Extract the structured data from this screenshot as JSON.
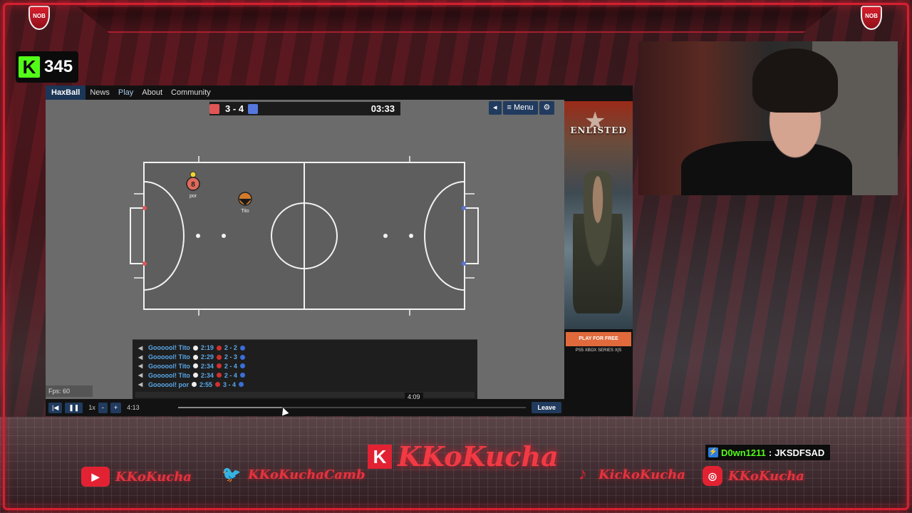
{
  "stream": {
    "viewer_count": "345",
    "kick_logo": "K",
    "crest_label": "NOB"
  },
  "haxball": {
    "nav": {
      "brand": "HaxBall",
      "links": [
        "News",
        "Play",
        "About",
        "Community"
      ]
    },
    "scoreboard": {
      "red_score": "3",
      "separator": "-",
      "blue_score": "4",
      "clock": "03:33",
      "red_color": "#e05555",
      "blue_color": "#5577dd"
    },
    "topbar": {
      "back_icon": "triangle-left-icon",
      "menu_label": "≡ Menu",
      "settings_icon": "gear-icon"
    },
    "players": [
      {
        "number": "8",
        "name": "por",
        "team": "red"
      },
      {
        "number": "",
        "name": "Tito",
        "team": "mixed"
      }
    ],
    "fps": "Fps: 60",
    "chat": [
      {
        "text": "Goooool! Tito",
        "time": "2:19",
        "score": "2 - 2"
      },
      {
        "text": "Goooool! Tito",
        "time": "2:29",
        "score": "2 - 3"
      },
      {
        "text": "Goooool! Tito",
        "time": "2:34",
        "score": "2 - 4"
      },
      {
        "text": "Goooool! Tito",
        "time": "2:34",
        "score": "2 - 4"
      },
      {
        "text": "Goooool! por",
        "time": "2:55",
        "score": "3 - 4"
      }
    ],
    "replay": {
      "prev_icon": "skip-back-icon",
      "pause_icon": "pause-icon",
      "speed": "1x",
      "minus": "-",
      "plus": "+",
      "current_time": "4:13",
      "hover_time": "4:09",
      "progress": 0.3,
      "leave": "Leave"
    },
    "ad": {
      "title": "ENLISTED",
      "button": "PLAY FOR FREE",
      "platforms": "PS5  XBOX SERIES X|S"
    }
  },
  "chat_overlay": {
    "user": "D0wn1211",
    "colon": ":",
    "message": "JKSDFSAD"
  },
  "socials": {
    "youtube": "KKoKucha",
    "twitter": "KKoKuchaCamb",
    "brand": "KKoKucha",
    "tiktok": "KickoKucha",
    "instagram": "KKoKucha",
    "brand_logo": "K"
  }
}
